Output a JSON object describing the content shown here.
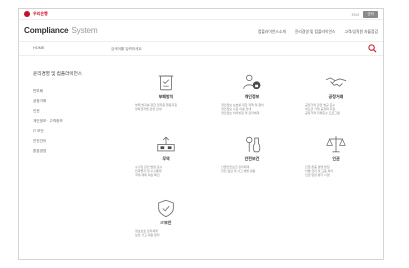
{
  "brand": {
    "name": "우리은행"
  },
  "topbar": {
    "link": "ENG",
    "button": "관리"
  },
  "logo": {
    "bold": "Compliance",
    "light": "System"
  },
  "nav": {
    "items": [
      "컴플라이언스소개",
      "윤리경영 및 컴플라이언스",
      "고객/임직원 자율점검"
    ]
  },
  "search": {
    "home_label": "HOME",
    "placeholder": "검색어를 입력하세요"
  },
  "sidebar": {
    "title": "윤리경영 및 컴플라이언스",
    "items": [
      "반부패",
      "공정거래",
      "인권",
      "개인정보 · 고객정보",
      "IT 보안",
      "안전관리",
      "환경경영"
    ]
  },
  "cards": [
    {
      "icon": "anti-corruption-icon",
      "title": "부패방지",
      "desc": [
        "부패 방지를 위한 임직원 행동지침",
        "청탁금지법 관련 안내"
      ]
    },
    {
      "icon": "privacy-icon",
      "title": "개인정보",
      "desc": [
        "개인정보 보호를 위한 정책 및 절차",
        "개인정보 수집·이용 안내",
        "개인정보 처리방침 및 관리체계"
      ]
    },
    {
      "icon": "handshake-icon",
      "title": "공정거래",
      "desc": [
        "공정거래 관련 법규 준수",
        "하도급 거래 공정화 지침",
        "공정거래 자율준수 프로그램"
      ]
    },
    {
      "icon": "trade-icon",
      "title": "무역",
      "desc": [
        "수출입 관련 법령 준수",
        "전략물자 및 수출통제",
        "국제 제재 대상 확인"
      ]
    },
    {
      "icon": "safety-icon",
      "title": "안전보건",
      "desc": [
        "산업안전보건 관리체계",
        "안전 점검 및 사고 예방 활동"
      ]
    },
    {
      "icon": "human-rights-icon",
      "title": "인권",
      "desc": [
        "인권 존중 경영 방침",
        "차별 금지 및 고충 처리",
        "인권 영향 평가 시행"
      ]
    },
    {
      "icon": "it-security-icon",
      "title": "IT보안",
      "desc": [
        "정보보호 관리체계",
        "보안 사고 대응 절차"
      ]
    }
  ],
  "colors": {
    "brand": "#c8102e",
    "icon_stroke": "#6b6b6b"
  }
}
